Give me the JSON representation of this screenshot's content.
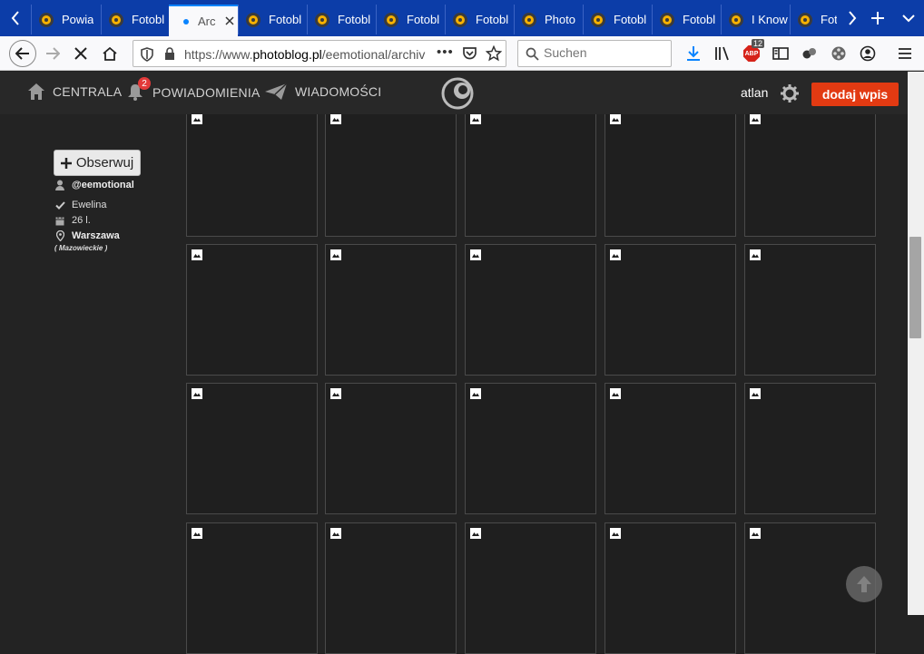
{
  "tabs": [
    {
      "label": "Powia",
      "active": false
    },
    {
      "label": "Fotobl",
      "active": false
    },
    {
      "label": "Arc",
      "active": true
    },
    {
      "label": "Fotobl",
      "active": false
    },
    {
      "label": "Fotobl",
      "active": false
    },
    {
      "label": "Fotobl",
      "active": false
    },
    {
      "label": "Fotobl",
      "active": false
    },
    {
      "label": "Photo",
      "active": false
    },
    {
      "label": "Fotobl",
      "active": false
    },
    {
      "label": "Fotobl",
      "active": false
    },
    {
      "label": "I Know",
      "active": false
    },
    {
      "label": "Foto",
      "active": false
    }
  ],
  "browser": {
    "url_prefix": "https://www.",
    "url_domain": "photoblog.pl",
    "url_path": "/eemotional/archiv",
    "search_placeholder": "Suchen",
    "abp_badge": "12",
    "new_tab": "+"
  },
  "site_header": {
    "centrala": "CENTRALA",
    "notifications": "POWIADOMIENIA",
    "notifications_count": "2",
    "messages": "WIADOMOŚCI",
    "username": "atlan",
    "add_entry": "dodaj wpis"
  },
  "profile": {
    "follow_label": "Obserwuj",
    "handle": "@eemotional",
    "name": "Ewelina",
    "age": "26 l.",
    "city": "Warszawa",
    "region": "( Mazowieckie )"
  },
  "colors": {
    "tabstrip": "#0c3da8",
    "accent": "#e23a12",
    "badge": "#e23a3a",
    "page_bg": "#232323"
  }
}
